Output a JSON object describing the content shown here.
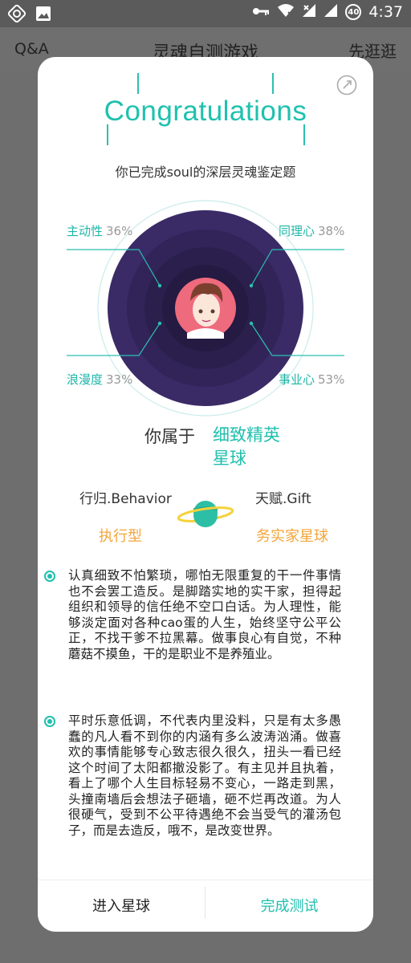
{
  "status_bar": {
    "time": "4:37",
    "battery_level": "40"
  },
  "app_bar": {
    "left_label": "Q&A",
    "title": "灵魂自测游戏",
    "right_label": "先逛逛"
  },
  "card": {
    "heading": "Congratulations",
    "subtitle": "你已完成soul的深层灵魂鉴定题",
    "traits": [
      {
        "name": "主动性",
        "percent": "36%"
      },
      {
        "name": "同理心",
        "percent": "38%"
      },
      {
        "name": "浪漫度",
        "percent": "33%"
      },
      {
        "name": "事业心",
        "percent": "53%"
      }
    ],
    "belong_label": "你属于",
    "planet_line1": "细致精英",
    "planet_line2": "星球",
    "behavior_label": "行归.Behavior",
    "gift_label": "天赋.Gift",
    "behavior_value": "执行型",
    "gift_value": "务实家星球",
    "paragraphs": [
      "认真细致不怕繁琐，哪怕无限重复的干一件事情也不会罢工造反。是脚踏实地的实干家，担得起组织和领导的信任绝不空口白话。为人理性，能够淡定面对各种cao蛋的人生，始终坚守公平公正，不找干爹不拉黑幕。做事良心有自觉，不种蘑菇不摸鱼，干的是职业不是养殖业。",
      "平时乐意低调，不代表内里没料，只是有太多愚蠢的凡人看不到你的内涵有多么波涛汹涌。做喜欢的事情能够专心致志很久很久，扭头一看已经这个时间了太阳都撤没影了。有主见并且执着，看上了哪个人生目标轻易不变心，一路走到黑，头撞南墙后会想法子砸墙，砸不烂再改道。为人很硬气，受到不公平待遇绝不会当受气的灌汤包子，而是去造反，哦不，是改变世界。"
    ],
    "enter_button": "进入星球",
    "done_button": "完成测试"
  },
  "colors": {
    "accent": "#1fbfae",
    "orange": "#f3a53b",
    "planet_dark": "#3a2b67"
  }
}
